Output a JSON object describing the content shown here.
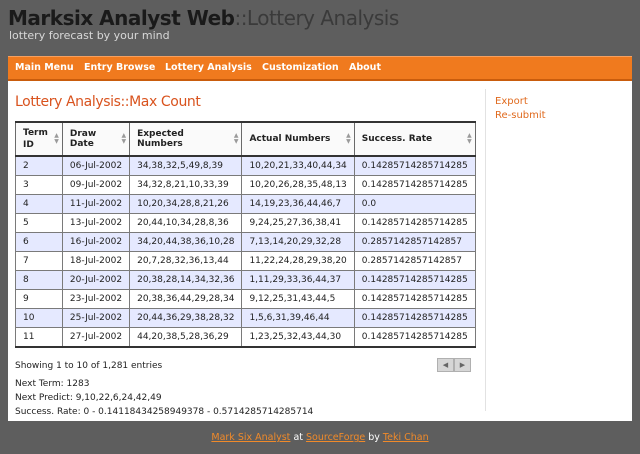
{
  "site": {
    "title_main": "Marksix Analyst Web",
    "title_sub": "::Lottery Analysis",
    "tagline": "lottery forecast by your mind"
  },
  "nav": [
    "Main Menu",
    "Entry Browse",
    "Lottery Analysis",
    "Customization",
    "About"
  ],
  "main": {
    "title": "Lottery Analysis::Max Count"
  },
  "side_links": [
    "Export",
    "Re-submit"
  ],
  "table": {
    "headers": [
      "Term ID",
      "Draw Date",
      "Expected Numbers",
      "Actual Numbers",
      "Success. Rate"
    ],
    "rows": [
      [
        "2",
        "06-Jul-2002",
        "34,38,32,5,49,8,39",
        "10,20,21,33,40,44,34",
        "0.14285714285714285"
      ],
      [
        "3",
        "09-Jul-2002",
        "34,32,8,21,10,33,39",
        "10,20,26,28,35,48,13",
        "0.14285714285714285"
      ],
      [
        "4",
        "11-Jul-2002",
        "10,20,34,28,8,21,26",
        "14,19,23,36,44,46,7",
        "0.0"
      ],
      [
        "5",
        "13-Jul-2002",
        "20,44,10,34,28,8,36",
        "9,24,25,27,36,38,41",
        "0.14285714285714285"
      ],
      [
        "6",
        "16-Jul-2002",
        "34,20,44,38,36,10,28",
        "7,13,14,20,29,32,28",
        "0.2857142857142857"
      ],
      [
        "7",
        "18-Jul-2002",
        "20,7,28,32,36,13,44",
        "11,22,24,28,29,38,20",
        "0.2857142857142857"
      ],
      [
        "8",
        "20-Jul-2002",
        "20,38,28,14,34,32,36",
        "1,11,29,33,36,44,37",
        "0.14285714285714285"
      ],
      [
        "9",
        "23-Jul-2002",
        "20,38,36,44,29,28,34",
        "9,12,25,31,43,44,5",
        "0.14285714285714285"
      ],
      [
        "10",
        "25-Jul-2002",
        "20,44,36,29,38,28,32",
        "1,5,6,31,39,46,44",
        "0.14285714285714285"
      ],
      [
        "11",
        "27-Jul-2002",
        "44,20,38,5,28,36,29",
        "1,23,25,32,43,44,30",
        "0.14285714285714285"
      ]
    ]
  },
  "info": "Showing 1 to 10 of 1,281 entries",
  "meta": {
    "next_term": "Next Term: 1283",
    "next_predict": "Next Predict: 9,10,22,6,24,42,49",
    "success_rate": "Success. Rate: 0 - 0.14118434258949378 - 0.5714285714285714"
  },
  "footer": {
    "link1": "Mark Six Analyst",
    "text1": " at ",
    "link2": "SourceForge",
    "text2": " by ",
    "link3": "Teki Chan"
  },
  "icons": {
    "prev": "left-arrow-icon",
    "next": "right-arrow-icon",
    "sort": "sort-arrows-icon"
  },
  "colors": {
    "accent": "#f07a1e",
    "title": "#d9531e",
    "link": "#e06a1e",
    "row_highlight": "#e5e9ff",
    "background": "#5e5e5e"
  }
}
